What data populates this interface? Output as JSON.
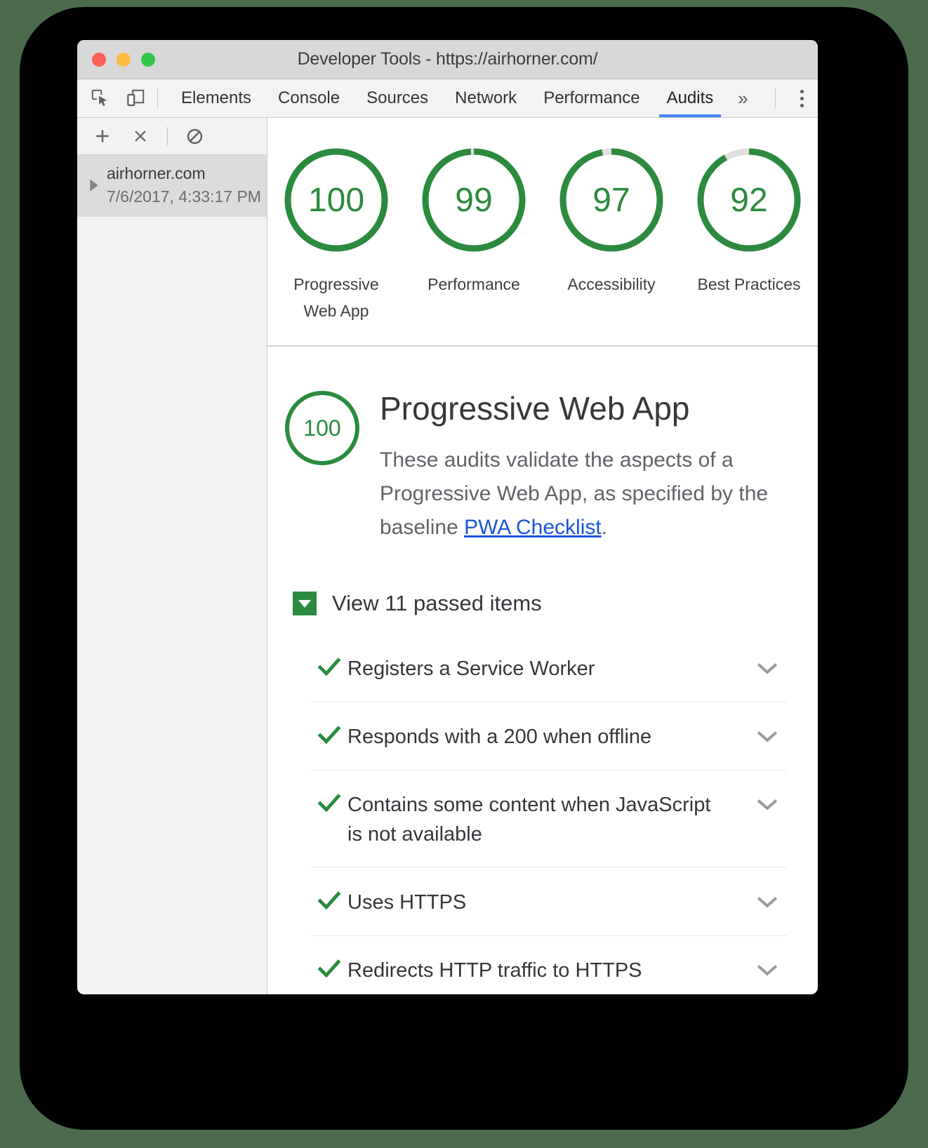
{
  "window": {
    "title": "Developer Tools - https://airhorner.com/",
    "traffic_lights": [
      "close",
      "minimize",
      "maximize"
    ]
  },
  "tabbar": {
    "icons": [
      "inspect-element-icon",
      "device-toolbar-icon"
    ],
    "tabs": [
      {
        "label": "Elements",
        "active": false
      },
      {
        "label": "Console",
        "active": false
      },
      {
        "label": "Sources",
        "active": false
      },
      {
        "label": "Network",
        "active": false
      },
      {
        "label": "Performance",
        "active": false
      },
      {
        "label": "Audits",
        "active": true
      }
    ],
    "more_label": "»",
    "menu_icon": "kebab-menu-icon"
  },
  "sidebar": {
    "toolbar": {
      "add_label": "+",
      "delete_label": "×",
      "clear_label": "clear-icon"
    },
    "run": {
      "host": "airhorner.com",
      "date": "7/6/2017, 4:33:17 PM",
      "expanded": false
    }
  },
  "gauges": [
    {
      "score": "100",
      "label": "Progressive Web App",
      "color": "#2b8a3e"
    },
    {
      "score": "99",
      "label": "Performance",
      "color": "#2b8a3e"
    },
    {
      "score": "97",
      "label": "Accessibility",
      "color": "#2b8a3e"
    },
    {
      "score": "92",
      "label": "Best Practices",
      "color": "#2b8a3e"
    }
  ],
  "category": {
    "score": "100",
    "title": "Progressive Web App",
    "desc_before": "These audits validate the aspects of a Progressive Web App, as specified by the baseline ",
    "link_text": "PWA Checklist",
    "desc_after": ".",
    "passed_toggle_label": "View 11 passed items",
    "passed_count": 11
  },
  "audits": [
    {
      "title": "Registers a Service Worker",
      "status": "pass"
    },
    {
      "title": "Responds with a 200 when offline",
      "status": "pass"
    },
    {
      "title": "Contains some content when JavaScript is not available",
      "status": "pass"
    },
    {
      "title": "Uses HTTPS",
      "status": "pass"
    },
    {
      "title": "Redirects HTTP traffic to HTTPS",
      "status": "pass"
    }
  ],
  "colors": {
    "pass_green": "#2b8a3e",
    "link_blue": "#1a55d8",
    "active_tab_blue": "#4285f4",
    "text_primary": "#33373b",
    "text_secondary": "#5f6368",
    "backdrop": "#000000",
    "page_background": "#4b6b4c"
  }
}
